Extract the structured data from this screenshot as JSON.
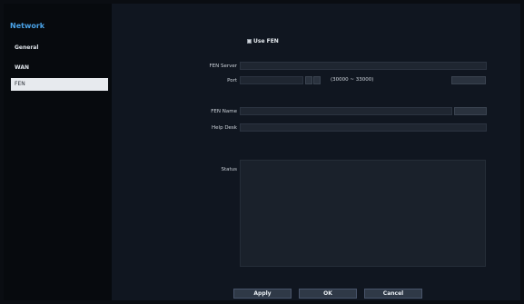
{
  "sidebar": {
    "title": "Network",
    "items": [
      {
        "label": "General"
      },
      {
        "label": "WAN"
      },
      {
        "label": "FEN"
      }
    ]
  },
  "form": {
    "use_fen_label": "Use FEN",
    "fen_server_label": "FEN Server",
    "port_label": "Port",
    "port_range": "(30000 ~ 33000)",
    "fen_name_label": "FEN Name",
    "help_desk_label": "Help Desk",
    "status_label": "Status"
  },
  "buttons": {
    "apply": "Apply",
    "ok": "OK",
    "cancel": "Cancel"
  },
  "colors": {
    "accent": "#4aa3e8",
    "active_item_bg": "#e7eaee"
  }
}
